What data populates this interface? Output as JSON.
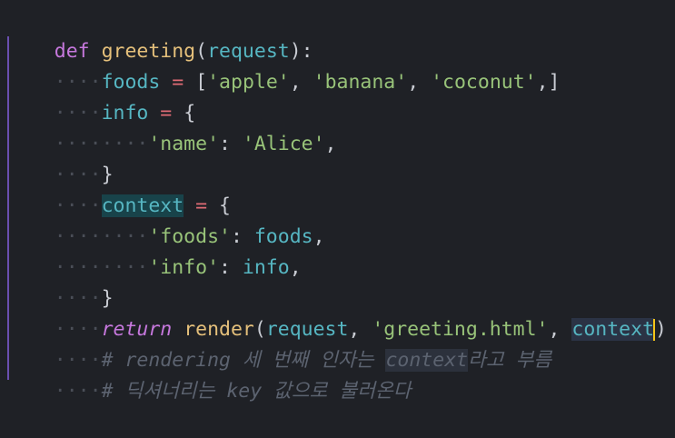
{
  "code": {
    "lines": [
      {
        "def_kw": "def",
        "fn_name": "greeting",
        "paren_open": "(",
        "param": "request",
        "paren_close": "):"
      },
      {
        "ws": "····",
        "var": "foods",
        "ws2": " ",
        "op": "=",
        "ws3": " ",
        "rest_open": "[",
        "s1": "'apple'",
        "c1": ",",
        "ws4": " ",
        "s2": "'banana'",
        "c2": ",",
        "ws5": " ",
        "s3": "'coconut'",
        "rest_close": ",]"
      },
      {
        "ws": "····",
        "var": "info",
        "ws2": " ",
        "op": "=",
        "ws3": " ",
        "brace": "{"
      },
      {
        "ws": "········",
        "key": "'name'",
        "colon": ":",
        "ws2": " ",
        "val": "'Alice'",
        "comma": ","
      },
      {
        "ws": "····",
        "brace": "}"
      },
      {
        "ws": "····",
        "var": "context",
        "ws2": " ",
        "op": "=",
        "ws3": " ",
        "brace": "{"
      },
      {
        "ws": "········",
        "key": "'foods'",
        "colon": ":",
        "ws2": " ",
        "val": "foods",
        "comma": ","
      },
      {
        "ws": "········",
        "key": "'info'",
        "colon": ":",
        "ws2": " ",
        "val": "info",
        "comma": ","
      },
      {
        "ws": "····",
        "brace": "}"
      },
      {
        "ws": "····",
        "ret": "return",
        "ws2": " ",
        "fn": "render",
        "open": "(",
        "a1": "request",
        "c1": ",",
        "ws3": " ",
        "a2": "'greeting.html'",
        "c2": ",",
        "ws4": " ",
        "a3": "context",
        "close": ")"
      },
      {
        "ws": "····",
        "hash": "#",
        "ws2": " ",
        "w1": "rendering",
        "ws3": " ",
        "w2": "세",
        "ws4": " ",
        "w3": "번째",
        "ws5": " ",
        "w4": "인자는",
        "ws6": " ",
        "w5": "context",
        "w6": "라고",
        "ws7": " ",
        "w7": "부름"
      },
      {
        "ws": "····",
        "hash": "#",
        "ws2": " ",
        "w1": "딕셔너리는",
        "ws3": " ",
        "w2": "key",
        "ws4": " ",
        "w3": "값으로",
        "ws5": " ",
        "w4": "불러온다"
      }
    ]
  },
  "colors": {
    "background": "#1f2126",
    "keyword": "#c678dd",
    "function": "#e5c07b",
    "variable": "#56b6c2",
    "string": "#98c379",
    "operator": "#e06c75",
    "comment": "#5c6370",
    "cursor": "#f5c518"
  }
}
